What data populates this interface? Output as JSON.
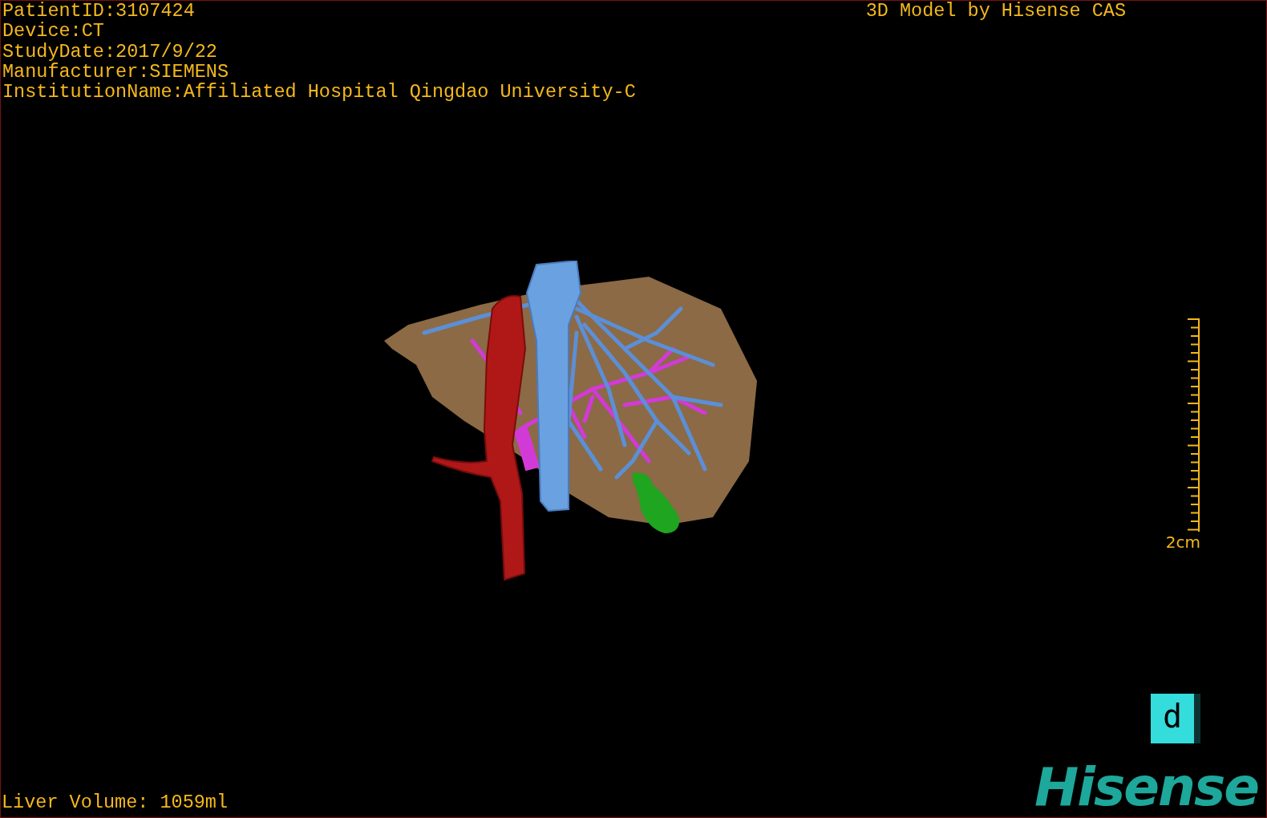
{
  "patient_info": [
    "PatientID:3107424",
    "Device:CT",
    "StudyDate:2017/9/22",
    "Manufacturer:SIEMENS",
    "InstitutionName:Affiliated Hospital Qingdao University-C"
  ],
  "title": "3D Model by Hisense CAS",
  "scale_bar": {
    "label": "2cm"
  },
  "liver_volume": "Liver Volume: 1059ml",
  "view_button": {
    "label": "d"
  },
  "logo": "Hisense"
}
